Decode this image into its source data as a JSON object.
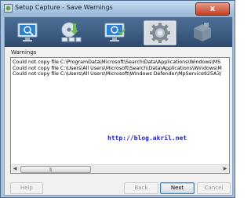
{
  "window": {
    "title": "Setup Capture - Save Warnings",
    "close_label": "x"
  },
  "steps": [
    {
      "name": "monitor"
    },
    {
      "name": "install"
    },
    {
      "name": "monitor-check"
    },
    {
      "name": "settings",
      "current": true
    },
    {
      "name": "package"
    }
  ],
  "warnings": {
    "label": "Warnings",
    "lines": [
      "Could not copy file C:\\ProgramData\\Microsoft\\Search\\Data\\Applications\\Windows\\MS",
      "Could not copy file C:\\Users\\All Users\\Microsoft\\Search\\Data\\Applications\\Windows\\M",
      "Could not copy file C:\\Users\\All Users\\Microsoft\\Windows Defender\\MpService925A3/"
    ],
    "watermark": "http://blog.akril.net"
  },
  "buttons": {
    "help": "Help",
    "back": "Back",
    "next": "Next",
    "cancel": "Cancel"
  }
}
